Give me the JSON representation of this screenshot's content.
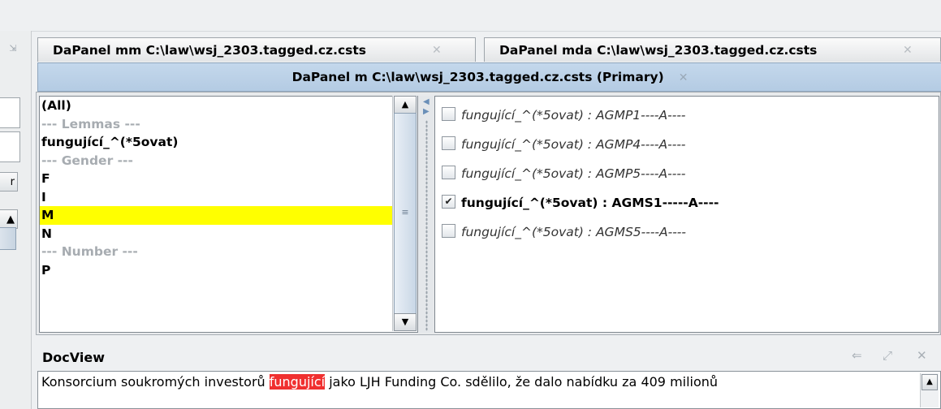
{
  "tabs": [
    {
      "label": "DaPanel mm C:\\law\\wsj_2303.tagged.cz.csts",
      "close": "✕"
    },
    {
      "label": "DaPanel mda C:\\law\\wsj_2303.tagged.cz.csts",
      "close": "✕"
    }
  ],
  "primary_tab": {
    "label": "DaPanel m C:\\law\\wsj_2303.tagged.cz.csts (Primary)",
    "close": "✕"
  },
  "filter_list": {
    "items": [
      {
        "text": "(All)",
        "kind": "value"
      },
      {
        "text": "--- Lemmas ---",
        "kind": "header"
      },
      {
        "text": "fungující_^(*5ovat)",
        "kind": "value"
      },
      {
        "text": "--- Gender ---",
        "kind": "header"
      },
      {
        "text": "F",
        "kind": "value"
      },
      {
        "text": "I",
        "kind": "value"
      },
      {
        "text": "M",
        "kind": "value",
        "selected": true
      },
      {
        "text": "N",
        "kind": "value"
      },
      {
        "text": "--- Number ---",
        "kind": "header"
      },
      {
        "text": "P",
        "kind": "value"
      }
    ]
  },
  "tag_options": [
    {
      "text": "fungující_^(*5ovat) : AGMP1----A----",
      "checked": false
    },
    {
      "text": "fungující_^(*5ovat) : AGMP4----A----",
      "checked": false
    },
    {
      "text": "fungující_^(*5ovat) : AGMP5----A----",
      "checked": false
    },
    {
      "text": "fungující_^(*5ovat) : AGMS1-----A----",
      "checked": true
    },
    {
      "text": "fungující_^(*5ovat) : AGMS5----A----",
      "checked": false
    }
  ],
  "docview": {
    "title": "DocView",
    "text_before": "Konsorcium soukromých investorů ",
    "highlight": "fungující",
    "text_after": " jako LJH Funding Co. sdělilo, že dalo nabídku za 409 milionů",
    "icons": [
      "pin-icon",
      "maximize-icon",
      "close-icon"
    ]
  },
  "colors": {
    "selection": "#ffff00",
    "primary_tab": "#b4cbe3",
    "highlight": "#f03030"
  }
}
